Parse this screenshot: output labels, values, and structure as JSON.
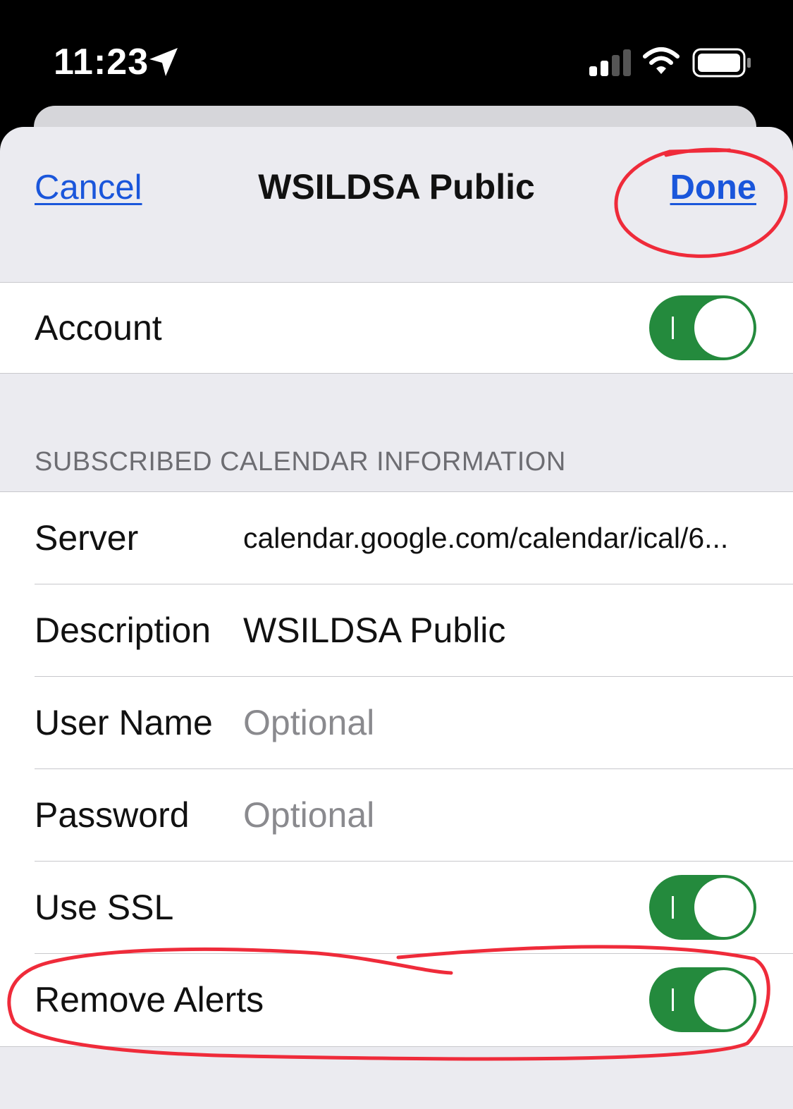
{
  "status_bar": {
    "time": "11:23",
    "icons": [
      "location-arrow-icon",
      "cellular-signal-icon",
      "wifi-icon",
      "battery-icon"
    ]
  },
  "nav": {
    "cancel_label": "Cancel",
    "title": "WSILDSA Public",
    "done_label": "Done"
  },
  "account": {
    "label": "Account",
    "toggle_on": true
  },
  "section_header": "SUBSCRIBED CALENDAR INFORMATION",
  "fields": {
    "server": {
      "label": "Server",
      "value": "calendar.google.com/calendar/ical/6..."
    },
    "description": {
      "label": "Description",
      "value": "WSILDSA Public"
    },
    "user_name": {
      "label": "User Name",
      "placeholder": "Optional"
    },
    "password": {
      "label": "Password",
      "placeholder": "Optional"
    },
    "use_ssl": {
      "label": "Use SSL",
      "toggle_on": true
    },
    "remove_alerts": {
      "label": "Remove Alerts",
      "toggle_on": true
    }
  },
  "colors": {
    "accent": "#1a56db",
    "toggle_on": "#248a3d",
    "annotation_marker": "#ef2b3a",
    "background": "#ebebf0"
  }
}
